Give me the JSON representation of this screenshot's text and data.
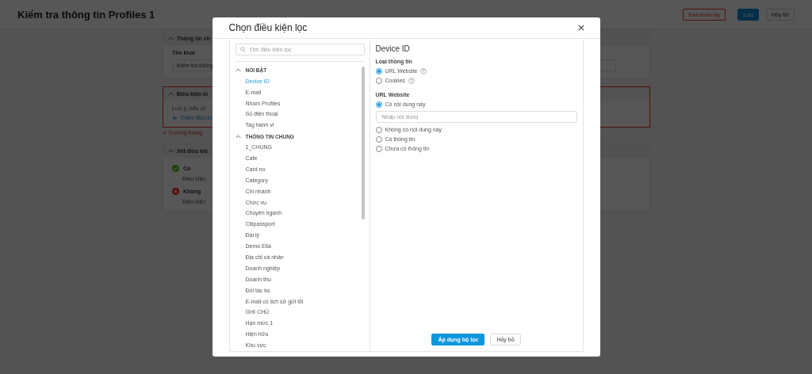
{
  "page": {
    "title": "Kiểm tra thông tin Profiles 1",
    "buttons": [
      {
        "label": "Xóa khối này",
        "kind": "danger"
      },
      {
        "label": "Lưu",
        "kind": "primary"
      },
      {
        "label": "Hủy bỏ",
        "kind": "default"
      }
    ]
  },
  "sections": [
    {
      "title": "Thông tin ch",
      "error": false,
      "lines": [
        {
          "kind": "label",
          "text": "Tên khối"
        },
        {
          "kind": "field",
          "text": "Kiểm tra thông"
        }
      ]
    },
    {
      "title": "Điều kiện ki",
      "error": true,
      "error_message": "Trường thông",
      "lines": [
        {
          "kind": "note",
          "text": "Lưu ý, nếu có"
        },
        {
          "kind": "link",
          "text": "Thêm điều ki"
        }
      ]
    },
    {
      "title": "Xét điều kiệ",
      "error": false,
      "lines": [
        {
          "kind": "yes",
          "text": "Có"
        },
        {
          "kind": "desc",
          "text": "Điều kiện"
        },
        {
          "kind": "no",
          "text": "Không"
        },
        {
          "kind": "desc",
          "text": "Điều kiện"
        }
      ]
    }
  ],
  "modal": {
    "title": "Chọn điều kiện lọc",
    "search": {
      "placeholder": "Tìm điều kiện lọc"
    },
    "groups": [
      {
        "label": "NỔI BẬT",
        "expanded": true,
        "children": [
          {
            "label": "Device ID",
            "selected": true
          },
          {
            "label": "E-mail",
            "selected": false
          },
          {
            "label": "Nhóm Profiles",
            "selected": false
          },
          {
            "label": "Số điện thoại",
            "selected": false
          },
          {
            "label": "Tag hành vi",
            "selected": false
          }
        ]
      },
      {
        "label": "THÔNG TIN CHUNG",
        "expanded": true,
        "children": [
          {
            "label": "1_CHUNG",
            "selected": false
          },
          {
            "label": "Cafe",
            "selected": false
          },
          {
            "label": "Card no",
            "selected": false
          },
          {
            "label": "Category",
            "selected": false
          },
          {
            "label": "Chi nhánh",
            "selected": false
          },
          {
            "label": "Chức vụ",
            "selected": false
          },
          {
            "label": "Chuyên ngành",
            "selected": false
          },
          {
            "label": "Citipassport",
            "selected": false
          },
          {
            "label": "Đại lý",
            "selected": false
          },
          {
            "label": "Demo Ella",
            "selected": false
          },
          {
            "label": "Địa chỉ cá nhân",
            "selected": false
          },
          {
            "label": "Doanh nghiệp",
            "selected": false
          },
          {
            "label": "Doanh thu",
            "selected": false
          },
          {
            "label": "Đối tác ks",
            "selected": false
          },
          {
            "label": "E-mail có lịch sử gửi lỗi",
            "selected": false
          },
          {
            "label": "GHI CHÚ",
            "selected": false
          },
          {
            "label": "Hạn mức 1",
            "selected": false
          },
          {
            "label": "Hiện hữu",
            "selected": false
          },
          {
            "label": "Khu vực",
            "selected": false
          }
        ]
      }
    ],
    "detail": {
      "title": "Device ID",
      "info_type": {
        "label": "Loại thông tin",
        "options": [
          {
            "label": "URL Website",
            "selected": true,
            "help": true
          },
          {
            "label": "Cookies",
            "selected": false,
            "help": true
          }
        ]
      },
      "condition": {
        "label": "URL Website",
        "options": [
          {
            "label": "Có nội dung này",
            "selected": true,
            "input_placeholder": "Nhập nội dung"
          },
          {
            "label": "Không có nội dung này",
            "selected": false
          },
          {
            "label": "Có thông tin",
            "selected": false
          },
          {
            "label": "Chưa có thông tin",
            "selected": false
          }
        ]
      }
    },
    "buttons": [
      {
        "label": "Áp dụng bộ lọc",
        "kind": "primary"
      },
      {
        "label": "Hủy bỏ",
        "kind": "default"
      }
    ]
  }
}
